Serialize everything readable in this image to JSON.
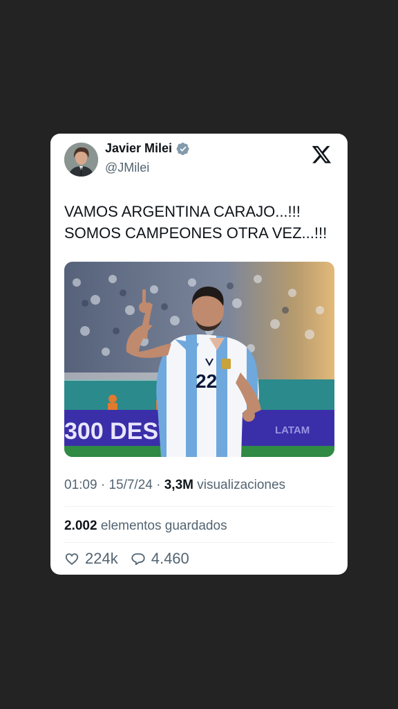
{
  "tweet": {
    "author_name": "Javier Milei",
    "author_handle": "@JMilei",
    "text_lines": [
      "VAMOS ARGENTINA CARAJO...!!!",
      "SOMOS CAMPEONES OTRA VEZ...!!!"
    ],
    "time": "01:09",
    "separator": "·",
    "date": "15/7/24",
    "views_count": "3,3M",
    "views_label": "visualizaciones",
    "bookmarks_count": "2.002",
    "bookmarks_label": "elementos guardados",
    "likes": "224k",
    "replies": "4.460"
  },
  "media": {
    "jersey_number": "22",
    "board_text": "300 DEST",
    "sponsor_text": "LATAM"
  },
  "icons": {
    "verified": "verified-badge-icon",
    "platform": "x-logo-icon",
    "like": "heart-icon",
    "reply": "comment-icon"
  },
  "colors": {
    "background": "#232323",
    "card": "#ffffff",
    "primary_text": "#0f1419",
    "secondary_text": "#536471",
    "verified_badge": "#829aab"
  }
}
